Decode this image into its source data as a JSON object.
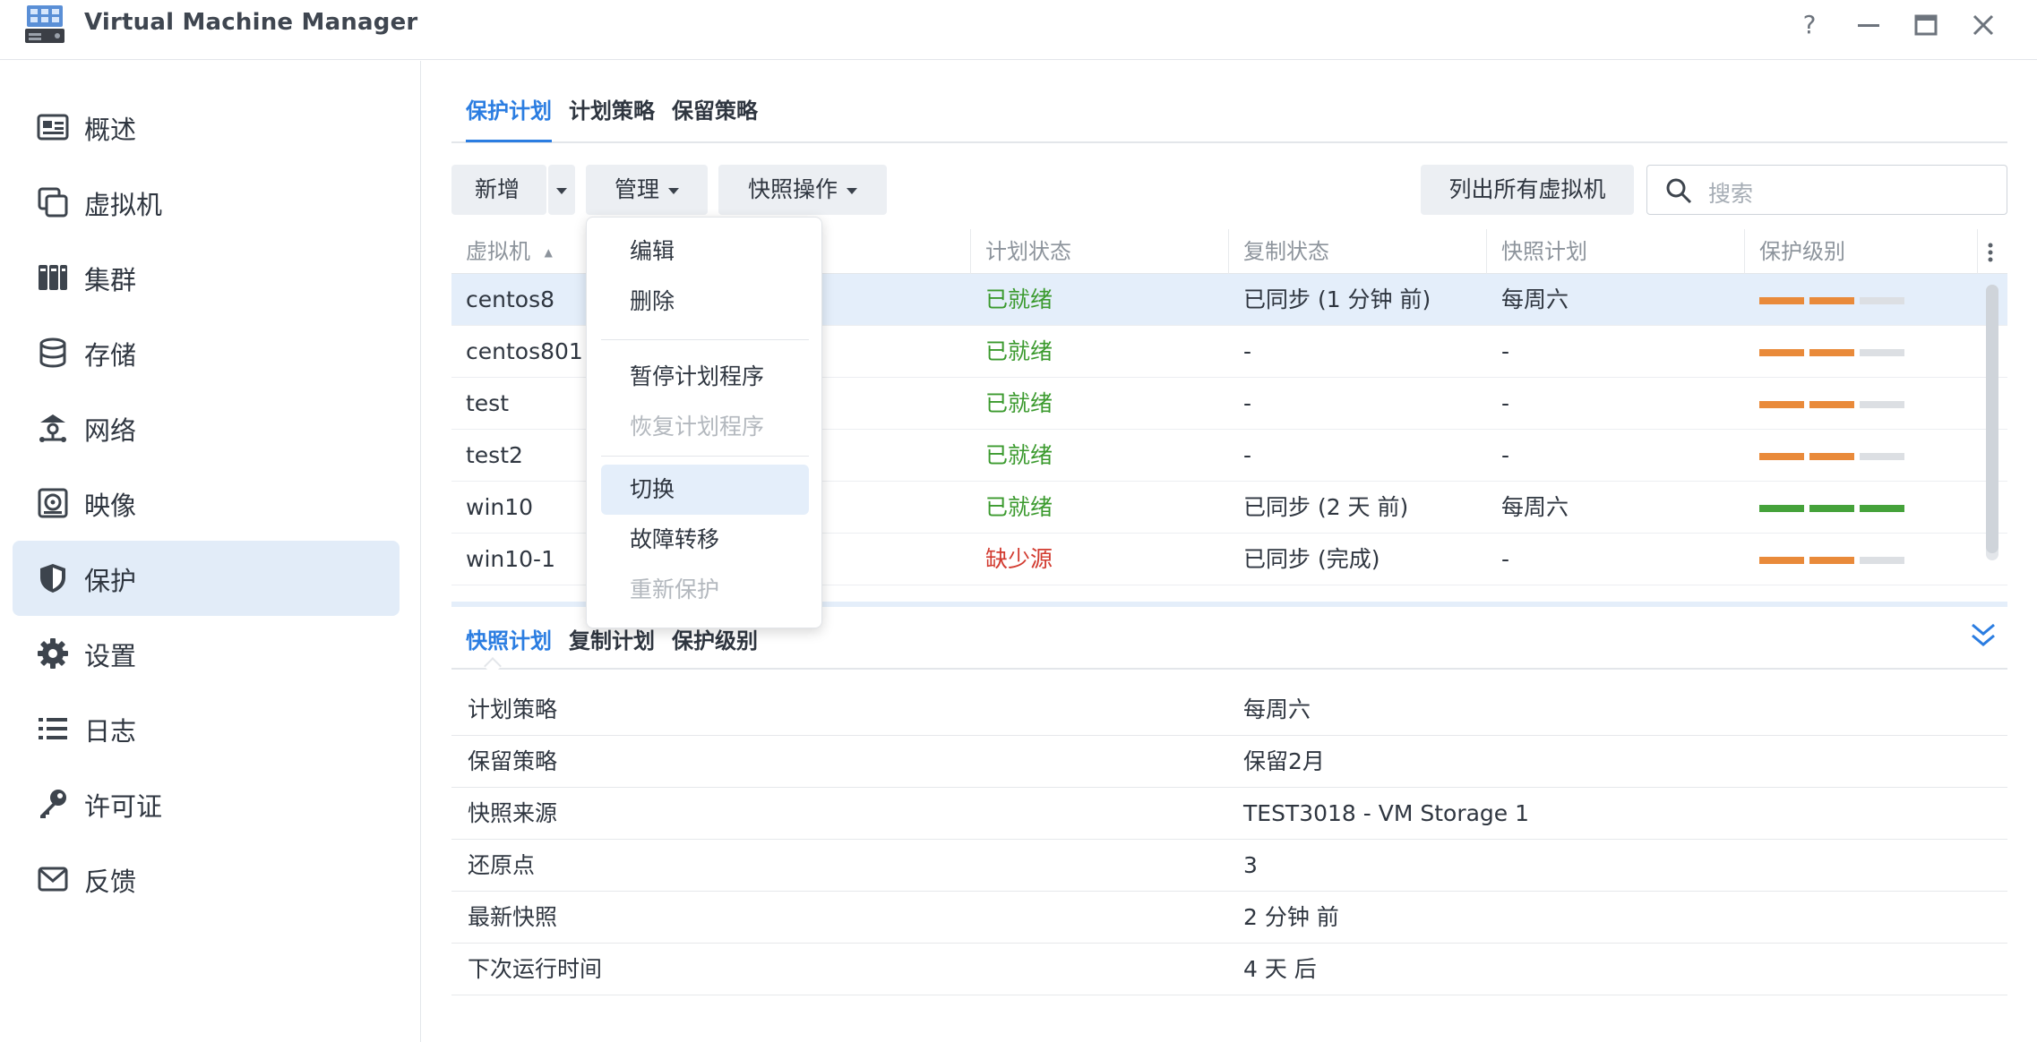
{
  "window": {
    "title": "Virtual Machine Manager",
    "controls": {
      "help": "?",
      "minimize": "—",
      "maximize": "▭",
      "close": "✕"
    }
  },
  "sidebar": {
    "items": [
      {
        "label": "概述",
        "icon": "overview-card-icon"
      },
      {
        "label": "虚拟机",
        "icon": "virtual-machine-icon"
      },
      {
        "label": "集群",
        "icon": "cluster-icon"
      },
      {
        "label": "存储",
        "icon": "storage-database-icon"
      },
      {
        "label": "网络",
        "icon": "network-icon"
      },
      {
        "label": "映像",
        "icon": "image-disc-icon"
      },
      {
        "label": "保护",
        "icon": "shield-icon"
      },
      {
        "label": "设置",
        "icon": "gear-icon"
      },
      {
        "label": "日志",
        "icon": "list-log-icon"
      },
      {
        "label": "许可证",
        "icon": "key-icon"
      },
      {
        "label": "反馈",
        "icon": "mail-icon"
      }
    ],
    "active_index": 6
  },
  "tabs": [
    {
      "label": "保护计划",
      "active": true
    },
    {
      "label": "计划策略",
      "active": false
    },
    {
      "label": "保留策略",
      "active": false
    }
  ],
  "toolbar": {
    "add_label": "新增",
    "manage_label": "管理",
    "snapshot_label": "快照操作",
    "list_all_label": "列出所有虚拟机",
    "search_placeholder": "搜索"
  },
  "grid": {
    "columns": [
      "虚拟机",
      "计划状态",
      "复制状态",
      "快照计划",
      "保护级别"
    ],
    "sort_indicator": "▲",
    "rows": [
      {
        "vm": "centos8",
        "plan_status": "已就绪",
        "status_type": "ok",
        "replication": "已同步 (1 分钟 前)",
        "snapshot_plan": "每周六",
        "level": 2,
        "level_color": "#e98a3a",
        "selected": true
      },
      {
        "vm": "centos801",
        "plan_status": "已就绪",
        "status_type": "ok",
        "replication": "-",
        "snapshot_plan": "-",
        "level": 2,
        "level_color": "#e98a3a",
        "selected": false
      },
      {
        "vm": "test",
        "plan_status": "已就绪",
        "status_type": "ok",
        "replication": "-",
        "snapshot_plan": "-",
        "level": 2,
        "level_color": "#e98a3a",
        "selected": false
      },
      {
        "vm": "test2",
        "plan_status": "已就绪",
        "status_type": "ok",
        "replication": "-",
        "snapshot_plan": "-",
        "level": 2,
        "level_color": "#e98a3a",
        "selected": false
      },
      {
        "vm": "win10",
        "plan_status": "已就绪",
        "status_type": "ok",
        "replication": "已同步 (2 天 前)",
        "snapshot_plan": "每周六",
        "level": 3,
        "level_color": "#45a23a",
        "selected": false
      },
      {
        "vm": "win10-1",
        "plan_status": "缺少源",
        "status_type": "warn",
        "replication": "已同步 (完成)",
        "snapshot_plan": "-",
        "level": 2,
        "level_color": "#e98a3a",
        "selected": false
      }
    ],
    "level_max": 3,
    "level_empty_color": "#dcdfe3"
  },
  "manage_menu": {
    "items": [
      {
        "label": "编辑",
        "disabled": false
      },
      {
        "label": "删除",
        "disabled": false
      },
      {
        "label": "暂停计划程序",
        "disabled": false
      },
      {
        "label": "恢复计划程序",
        "disabled": true
      },
      {
        "label": "切换",
        "disabled": false,
        "hover": true
      },
      {
        "label": "故障转移",
        "disabled": false
      },
      {
        "label": "重新保护",
        "disabled": true
      }
    ]
  },
  "detail_tabs": [
    {
      "label": "快照计划",
      "active": true
    },
    {
      "label": "复制计划",
      "active": false
    },
    {
      "label": "保护级别",
      "active": false
    }
  ],
  "details": [
    {
      "label": "计划策略",
      "value": "每周六"
    },
    {
      "label": "保留策略",
      "value": "保留2月"
    },
    {
      "label": "快照来源",
      "value": "TEST3018 - VM Storage 1"
    },
    {
      "label": "还原点",
      "value": "3"
    },
    {
      "label": "最新快照",
      "value": "2 分钟 前"
    },
    {
      "label": "下次运行时间",
      "value": "4 天 后"
    }
  ],
  "colors": {
    "accent": "#2b7de1",
    "ok": "#3b9a2e",
    "warn": "#d23b30",
    "selection": "#e4eefa"
  }
}
